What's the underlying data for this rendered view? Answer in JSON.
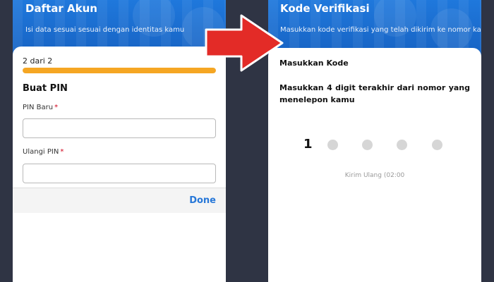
{
  "left_screen": {
    "header_title": "Daftar Akun",
    "header_subtitle": "Isi data sesuai sesuai dengan identitas kamu",
    "step_label": "2 dari 2",
    "progress": 1.0,
    "section_title": "Buat PIN",
    "pin_new_label": "PIN Baru",
    "pin_confirm_label": "Ulangi PIN",
    "required_mark": "*",
    "pin_new_value": "",
    "pin_confirm_value": "",
    "done_label": "Done"
  },
  "right_screen": {
    "header_title": "Kode Verifikasi",
    "header_subtitle": "Masukkan kode verifikasi yang telah dikirim ke nomor kamu",
    "heading": "Masukkan Kode",
    "instruction": "Masukkan 4 digit terakhir dari nomor yang menelepon kamu",
    "code_digits": [
      "1",
      "",
      "",
      "",
      ""
    ],
    "resend_text": "Kirim Ulang (02:00"
  },
  "colors": {
    "header_blue": "#1563c4",
    "progress_orange": "#f5a623",
    "done_blue": "#2878d8",
    "arrow_red": "#e32b27",
    "required_red": "#d0021b"
  },
  "icons": {
    "arrow": "red-right-arrow-icon"
  }
}
